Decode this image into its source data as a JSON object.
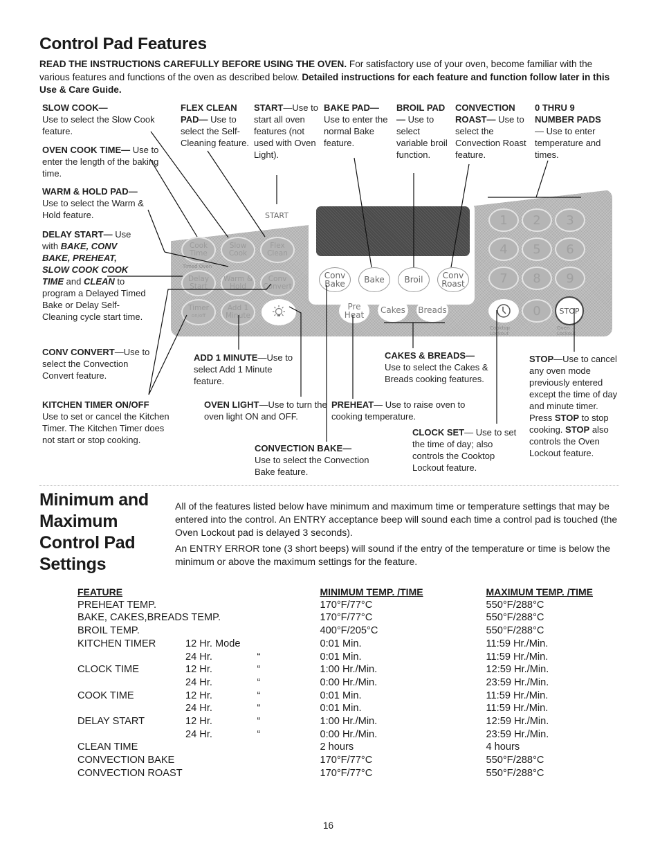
{
  "header": {
    "title": "Control Pad Features",
    "intro_bold_1": "READ THE INSTRUCTIONS CAREFULLY BEFORE USING THE OVEN.",
    "intro_text": " For satisfactory use of your oven, become familiar with the various features and functions of the oven as described below. ",
    "intro_bold_2": "Detailed instructions for each feature and function follow later in this Use & Care Guide."
  },
  "callouts": {
    "slow_cook": {
      "title": "SLOW COOK—",
      "desc": "Use to select the Slow Cook feature."
    },
    "oven_cook_time": {
      "title": "OVEN COOK TIME—",
      "desc_inline": " Use",
      "desc": "to enter the length of the baking time."
    },
    "warm_hold": {
      "title": "WARM & HOLD PAD—",
      "desc": "Use to select the Warm & Hold feature."
    },
    "delay_start": {
      "title": "DELAY START—",
      "desc_1": " Use with ",
      "em_1": "BAKE, CONV BAKE, PREHEAT, SLOW COOK COOK TIME",
      "desc_2": " and ",
      "em_2": "CLEAN",
      "desc_3": " to program a Delayed Timed Bake or Delay Self-Cleaning cycle start time."
    },
    "conv_convert": {
      "title": "CONV CONVERT",
      "desc_inline": "—Use",
      "desc": "to select the Convection Convert feature."
    },
    "kitchen_timer": {
      "title": "KITCHEN TIMER ON/OFF",
      "desc": "Use  to set or cancel the Kitchen Timer. The Kitchen Timer does not start or stop cooking."
    },
    "flex_clean": {
      "title": "FLEX CLEAN PAD—",
      "desc": " Use to select the Self-Cleaning feature."
    },
    "start": {
      "title": "START",
      "desc_inline": "—Use",
      "desc": "to start all oven features (not used with Oven Light)."
    },
    "bake_pad": {
      "title": "BAKE PAD—",
      "desc": "Use to enter the normal Bake feature."
    },
    "broil_pad": {
      "title": "BROIL PAD—",
      "desc": " Use to select variable broil function."
    },
    "convection_roast": {
      "title": "CONVECTION ROAST—",
      "desc": " Use to select the Convection Roast feature."
    },
    "number_pads": {
      "title": "0 THRU 9 NUMBER PADS",
      "desc": "— Use to enter temperature and times."
    },
    "add_1_minute": {
      "title": "ADD 1 MINUTE",
      "desc_inline": "—Use",
      "desc": "to select Add 1 Minute feature."
    },
    "oven_light": {
      "title": "OVEN LIGHT",
      "desc": "—Use to turn the oven light ON and OFF."
    },
    "convection_bake": {
      "title": "CONVECTION BAKE—",
      "desc": "Use to select the Convection Bake feature."
    },
    "preheat": {
      "title": "PREHEAT",
      "desc": "— Use to raise oven to cooking temperature."
    },
    "cakes_breads": {
      "title": "CAKES & BREADS—",
      "desc": "Use to select the Cakes & Breads cooking features."
    },
    "clock_set": {
      "title": "CLOCK SET",
      "desc": "— Use to set the time of day; also controls the Cooktop Lockout feature."
    },
    "stop": {
      "title": "STOP",
      "desc_1": "—Use to cancel any oven mode previously entered except the time of day and minute timer. Press ",
      "em_1": "STOP",
      "desc_2": " to stop cooking. ",
      "em_2": "STOP",
      "desc_3": " also controls the Oven Lockout feature."
    }
  },
  "panel": {
    "start": "START",
    "cook_time": "Cook Time",
    "slow_cook": "Slow Cook",
    "flex_clean": "Flex Clean",
    "timed_oven": "Timed Oven",
    "delay_start": "Delay Start",
    "warm_hold": "Warm & Hold",
    "conv_convert": "Conv Convert",
    "timer": "Timer",
    "timer_sub": "on/off",
    "add_1_minute": "Add 1 Minute",
    "light_icon": "lightbulb-icon",
    "conv_bake": "Conv Bake",
    "bake": "Bake",
    "broil": "Broil",
    "conv_roast": "Conv Roast",
    "preheat": "Pre Heat",
    "cakes": "Cakes",
    "breads": "Breads",
    "numbers": [
      "1",
      "2",
      "3",
      "4",
      "5",
      "6",
      "7",
      "8",
      "9",
      "0"
    ],
    "clock_icon": "clock-icon",
    "cooktop_lockout": "Cooktop Lockout",
    "oven_lockout": "Oven Lockout",
    "stop": "STOP"
  },
  "section2": {
    "title": "Minimum and Maximum Control Pad Settings",
    "para1": "All of the features listed below have minimum and maximum time or temperature settings that may be entered into the control. An ENTRY acceptance beep will sound each time a control pad is touched (the Oven Lockout  pad is delayed 3 seconds).",
    "para2": "An ENTRY ERROR tone (3 short beeps) will sound if the entry of the temperature or time is below the minimum or above the maximum settings for the feature."
  },
  "settings_table": {
    "headers": {
      "feature": "FEATURE",
      "minimum": "MINIMUM TEMP. /TIME",
      "maximum": "MAXIMUM TEMP. /TIME"
    },
    "rows": [
      {
        "feature": "PREHEAT TEMP.",
        "mode": "",
        "ditto": "",
        "min": "170°F/77°C",
        "max": "550°F/288°C"
      },
      {
        "feature": "BAKE, CAKES,BREADS TEMP.",
        "mode": "",
        "ditto": "",
        "min": "170°F/77°C",
        "max": "550°F/288°C"
      },
      {
        "feature": "BROIL TEMP.",
        "mode": "",
        "ditto": "",
        "min": "400°F/205°C",
        "max": "550°F/288°C"
      },
      {
        "feature": "KITCHEN TIMER",
        "mode": "12 Hr. Mode",
        "ditto": "",
        "min": "0:01 Min.",
        "max": "11:59 Hr./Min."
      },
      {
        "feature": "",
        "mode": "24 Hr.",
        "ditto": "“",
        "min": "0:01 Min.",
        "max": "11:59 Hr./Min."
      },
      {
        "feature": "CLOCK TIME",
        "mode": "12 Hr.",
        "ditto": "“",
        "min": "1:00 Hr./Min.",
        "max": "12:59 Hr./Min."
      },
      {
        "feature": "",
        "mode": "24 Hr.",
        "ditto": "“",
        "min": "0:00 Hr./Min.",
        "max": "23:59 Hr./Min."
      },
      {
        "feature": "COOK TIME",
        "mode": "12 Hr.",
        "ditto": "“",
        "min": "0:01 Min.",
        "max": "11:59 Hr./Min."
      },
      {
        "feature": "",
        "mode": "24 Hr.",
        "ditto": "“",
        "min": "0:01 Min.",
        "max": "11:59 Hr./Min."
      },
      {
        "feature": "DELAY START",
        "mode": "12 Hr.",
        "ditto": "“",
        "min": "1:00 Hr./Min.",
        "max": "12:59 Hr./Min."
      },
      {
        "feature": "",
        "mode": "24 Hr.",
        "ditto": "“",
        "min": "0:00 Hr./Min.",
        "max": "23:59 Hr./Min."
      },
      {
        "feature": "CLEAN TIME",
        "mode": "",
        "ditto": "",
        "min": "2 hours",
        "max": "4 hours"
      },
      {
        "feature": "CONVECTION BAKE",
        "mode": "",
        "ditto": "",
        "min": "170°F/77°C",
        "max": "550°F/288°C"
      },
      {
        "feature": "CONVECTION ROAST",
        "mode": "",
        "ditto": "",
        "min": "170°F/77°C",
        "max": "550°F/288°C"
      }
    ]
  },
  "footer": {
    "page_number": "16"
  }
}
